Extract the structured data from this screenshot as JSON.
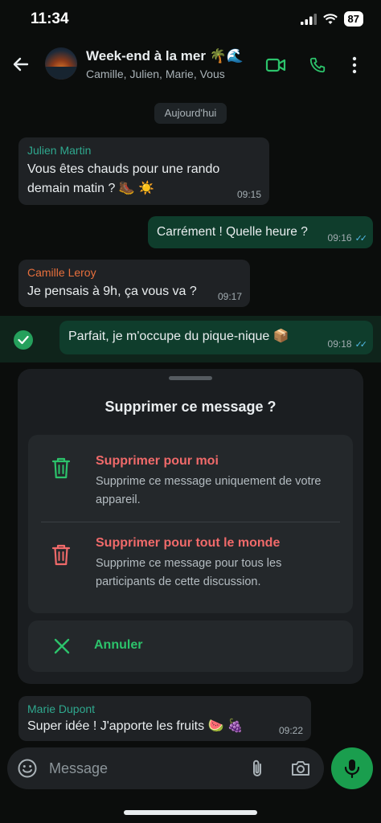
{
  "status": {
    "time": "11:34",
    "battery": "87"
  },
  "header": {
    "title": "Week-end à la mer 🌴🌊",
    "subtitle": "Camille, Julien, Marie, Vous"
  },
  "chat": {
    "date_label": "Aujourd'hui",
    "messages": [
      {
        "sender": "Julien Martin",
        "sender_color": "#2fa88e",
        "text": "Vous êtes chauds pour une rando demain matin ? 🥾 ☀️",
        "time": "09:15",
        "direction": "in"
      },
      {
        "text": "Carrément ! Quelle heure ?",
        "time": "09:16",
        "direction": "out",
        "read": true
      },
      {
        "sender": "Camille Leroy",
        "sender_color": "#e76f3c",
        "text": "Je pensais à 9h, ça vous va ?",
        "time": "09:17",
        "direction": "in"
      },
      {
        "text": "Parfait, je m'occupe du pique-nique 📦",
        "time": "09:18",
        "direction": "out",
        "read": true,
        "selected": true
      },
      {
        "sender": "Marie Dupont",
        "sender_color": "#2fa88e",
        "text": "Super idée ! J'apporte les fruits 🍉 🍇",
        "time": "09:22",
        "direction": "in"
      }
    ]
  },
  "sheet": {
    "title": "Supprimer ce message ?",
    "options": [
      {
        "label": "Supprimer pour moi",
        "description": "Supprime ce message uniquement de votre appareil.",
        "icon": "trash-icon",
        "icon_color": "#2cc36b"
      },
      {
        "label": "Supprimer pour tout le monde",
        "description": "Supprime ce message pour tous les participants de cette discussion.",
        "icon": "trash-icon",
        "icon_color": "#f06a6a"
      }
    ],
    "cancel_label": "Annuler"
  },
  "composer": {
    "placeholder": "Message"
  },
  "colors": {
    "accent": "#2cc36b",
    "danger": "#f06a6a",
    "outgoing_bubble": "#0f3d2c",
    "incoming_bubble": "#1f2225"
  }
}
